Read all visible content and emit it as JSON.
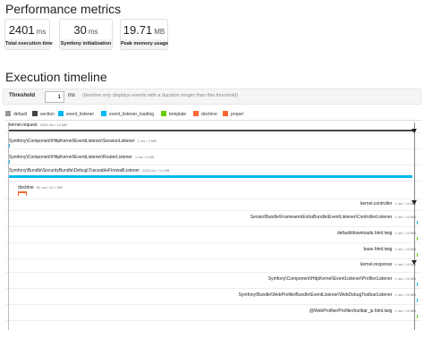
{
  "page": {
    "performance_title": "Performance metrics",
    "timeline_title": "Execution timeline"
  },
  "metrics": [
    {
      "value": "2401",
      "unit": "ms",
      "label": "Total execution time"
    },
    {
      "value": "30",
      "unit": "ms",
      "label": "Symfony initialization"
    },
    {
      "value": "19.71",
      "unit": "MB",
      "label": "Peak memory usage"
    }
  ],
  "threshold": {
    "label": "Threshold",
    "value": "1",
    "unit": "ms",
    "hint": "(timeline only displays events with a duration longer than this threshold)"
  },
  "legend": [
    {
      "label": "default",
      "color": "#999999"
    },
    {
      "label": "section",
      "color": "#444444"
    },
    {
      "label": "event_listener",
      "color": "#00b8f5"
    },
    {
      "label": "event_listener_loading",
      "color": "#00b8f5"
    },
    {
      "label": "template",
      "color": "#66cc00"
    },
    {
      "label": "doctrine",
      "color": "#ff6633"
    },
    {
      "label": "propel",
      "color": "#ff6633"
    }
  ],
  "timeline": {
    "events": [
      {
        "name": "kernel.request",
        "meta": "2349 ms / 14 MB",
        "align": "left"
      },
      {
        "name": "Symfony\\Component\\HttpKernel\\EventListener\\SessionListener",
        "meta": "1 ms / 2 MB",
        "align": "left"
      },
      {
        "name": "Symfony\\Component\\HttpKernel\\EventListener\\RouterListener",
        "meta": "1 ms / 2 MB",
        "align": "left"
      },
      {
        "name": "Symfony\\Bundle\\SecurityBundle\\Debug\\TraceableFirewallListener",
        "meta": "2343 ms / 14 MB",
        "align": "left"
      },
      {
        "name": "doctrine",
        "meta": "52 ms / 19.7 MB",
        "align": "left"
      },
      {
        "name": "kernel.controller",
        "meta": "1 ms / 14 MB",
        "align": "right"
      },
      {
        "name": "Sensio\\Bundle\\FrameworkExtraBundle\\EventListener\\ControllerListener",
        "meta": "1 ms / 14 MB",
        "align": "right"
      },
      {
        "name": "default/downloads.html.twig",
        "meta": "1 ms / 14 MB",
        "align": "right"
      },
      {
        "name": "base.html.twig",
        "meta": "1 ms / 14 MB",
        "align": "right"
      },
      {
        "name": "kernel.response",
        "meta": "1 ms / 14 MB",
        "align": "right"
      },
      {
        "name": "Symfony\\Component\\HttpKernel\\EventListener\\ProfilerListener",
        "meta": "1 ms / 14 MB",
        "align": "right"
      },
      {
        "name": "Symfony\\Bundle\\WebProfilerBundle\\EventListener\\WebDebugToolbarListener",
        "meta": "1 ms / 14 MB",
        "align": "right"
      },
      {
        "name": "@WebProfiler/Profiler/toolbar_js.html.twig",
        "meta": "1 ms / 14 MB",
        "align": "right"
      }
    ]
  }
}
